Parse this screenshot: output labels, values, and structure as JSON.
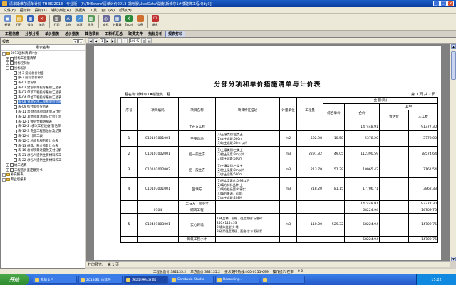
{
  "window": {
    "title": "清华斯维尔清单计价 TH-BQ2013 - 专业版 - [F:\\THSware\\清单计价2013 湖南版\\UserData\\湖南\\斯维尔1#楼建筑工程.Qdy3]",
    "min": "_",
    "max": "□",
    "close": "×"
  },
  "menu": [
    "文件(F)",
    "招标标",
    "投标(T)",
    "辅助功能(A)",
    "数据库",
    "工具",
    "窗口(W)",
    "帮助(H)"
  ],
  "toolbar": [
    {
      "label": "新建",
      "icon": "new-file-icon",
      "color": "#6a8fd0",
      "glyph": "▣"
    },
    {
      "label": "打开",
      "icon": "folder-open-icon",
      "color": "#d8a830",
      "glyph": "▤"
    },
    {
      "label": "保存",
      "icon": "save-icon",
      "color": "#3060b8",
      "glyph": "▦"
    },
    {
      "label": "关闭",
      "icon": "close-file-icon",
      "color": "#c04030",
      "glyph": "✕"
    },
    {
      "label": "打印",
      "icon": "printer-icon",
      "color": "#707070",
      "glyph": "▥"
    },
    {
      "label": "字符",
      "icon": "font-icon",
      "color": "#4070b0",
      "glyph": "A"
    },
    {
      "label": "选项",
      "icon": "options-icon",
      "color": "#4a90d0",
      "glyph": "✓"
    },
    {
      "label": "显示",
      "icon": "display-icon",
      "color": "#5a9a5a",
      "glyph": "▩"
    },
    {
      "label": "查找",
      "icon": "search-icon",
      "color": "#6a6a9a",
      "glyph": "◎"
    },
    {
      "label": "计算器",
      "icon": "calculator-icon",
      "color": "#5a7ab0",
      "glyph": "▦"
    },
    {
      "label": "Excel",
      "icon": "excel-icon",
      "color": "#2a8a3a",
      "glyph": "X"
    },
    {
      "label": "信息",
      "icon": "info-icon",
      "color": "#d07030",
      "glyph": "i"
    },
    {
      "label": "退出",
      "icon": "exit-icon",
      "color": "#c03030",
      "glyph": "⏻"
    }
  ],
  "tabs": [
    "工程信息",
    "分部分项",
    "单价措施",
    "总价措施",
    "其他项目",
    "工料机汇总",
    "取费文件",
    "指标分析",
    "报表打印"
  ],
  "active_tab_index": 8,
  "left_panel": {
    "header": "报表",
    "title": "报表名称",
    "btn_add": "+",
    "btn_close": "×",
    "items": [
      {
        "indent": 0,
        "exp": "-",
        "type": "folder",
        "label": "2013国标清单计价",
        "selected": false
      },
      {
        "indent": 1,
        "exp": "+",
        "type": "check",
        "label": "招标工程量清单",
        "selected": false
      },
      {
        "indent": 1,
        "exp": "+",
        "type": "check",
        "label": "招标控制价",
        "selected": false
      },
      {
        "indent": 1,
        "exp": "-",
        "type": "check",
        "label": "投标报价",
        "selected": false
      },
      {
        "indent": 2,
        "exp": "",
        "type": "check",
        "label": "封-3 投标总价封面",
        "selected": false
      },
      {
        "indent": 2,
        "exp": "",
        "type": "check",
        "label": "扉-3 投标总价扉页",
        "selected": false
      },
      {
        "indent": 2,
        "exp": "",
        "type": "check",
        "label": "表-01 总说明",
        "selected": false
      },
      {
        "indent": 2,
        "exp": "",
        "type": "check",
        "label": "表-02 建设项目投标报价汇总表",
        "selected": false
      },
      {
        "indent": 2,
        "exp": "",
        "type": "check",
        "label": "表-03 单项工程投标报价汇总表",
        "selected": false
      },
      {
        "indent": 2,
        "exp": "",
        "type": "check",
        "label": "表-04 单位工程投标报价汇总表",
        "selected": false
      },
      {
        "indent": 2,
        "exp": "",
        "type": "check",
        "label": "表-08 分部分项工程和单价措施",
        "selected": true
      },
      {
        "indent": 2,
        "exp": "",
        "type": "check",
        "label": "表-09 综合单价分析表",
        "selected": false
      },
      {
        "indent": 2,
        "exp": "",
        "type": "check",
        "label": "表-11 总价措施项目清单与计价",
        "selected": false
      },
      {
        "indent": 2,
        "exp": "",
        "type": "check",
        "label": "表-12 其他项目清单与计价汇总",
        "selected": false
      },
      {
        "indent": 2,
        "exp": "",
        "type": "check",
        "label": "表-12-1 暂列金额明细表",
        "selected": false
      },
      {
        "indent": 2,
        "exp": "",
        "type": "check",
        "label": "表-12-2 材料(工程设备)暂估单",
        "selected": false
      },
      {
        "indent": 2,
        "exp": "",
        "type": "check",
        "label": "表-12-3 专业工程暂估价及结算",
        "selected": false
      },
      {
        "indent": 2,
        "exp": "",
        "type": "check",
        "label": "表-12-4 计日工表",
        "selected": false
      },
      {
        "indent": 2,
        "exp": "",
        "type": "check",
        "label": "表-12-5 总承包服务费计价表",
        "selected": false
      },
      {
        "indent": 2,
        "exp": "",
        "type": "check",
        "label": "表-13 规费、税金项目计价表",
        "selected": false
      },
      {
        "indent": 2,
        "exp": "",
        "type": "check",
        "label": "表-16 总价项目进度款支付分解",
        "selected": false
      },
      {
        "indent": 2,
        "exp": "",
        "type": "check",
        "label": "表-21 承包人提供主要材料和工",
        "selected": false
      },
      {
        "indent": 2,
        "exp": "",
        "type": "check",
        "label": "表-22 承包人提供主要材料和工",
        "selected": false
      },
      {
        "indent": 1,
        "exp": "+",
        "type": "check",
        "label": "竣工结算",
        "selected": false
      },
      {
        "indent": 1,
        "exp": "+",
        "type": "check",
        "label": "工程造价鉴定意见书",
        "selected": false
      },
      {
        "indent": 0,
        "exp": "+",
        "type": "folder",
        "label": "补充报表",
        "selected": false
      },
      {
        "indent": 0,
        "exp": "+",
        "type": "folder",
        "label": "专业版报表",
        "selected": false
      }
    ]
  },
  "doc_toolbar": {
    "page_input": "1",
    "zoom": "100 %"
  },
  "report": {
    "title": "分部分项和单价措施清单与计价表",
    "project_label": "工程名称:斯维尔1#楼建筑工程",
    "page_label": "第 1 页 共 2 页",
    "headers": {
      "seq": "序号",
      "code": "项目编码",
      "name": "项目名称",
      "feature": "项目特征描述",
      "unit": "计量单位",
      "qty": "工程量",
      "amount_group": "金 额(元)",
      "unit_price": "综合单价",
      "total": "合价",
      "of_which": "其中",
      "provisional": "暂估价",
      "labor": "人工费"
    },
    "rows": [
      {
        "kind": "section",
        "seq": "",
        "code": "",
        "name": "土石方工程",
        "feature": "",
        "unit": "",
        "qty": "",
        "price": "",
        "total": "147448.91",
        "prov": "",
        "labor": "91377.30",
        "h": 11
      },
      {
        "kind": "item",
        "seq": "1",
        "code": "010101001001",
        "name": "平整场地",
        "feature": "(1)土壤类别:三类土\n(2)弃土运距:500m\n(3)取土运距:50m 以内",
        "unit": "m2",
        "qty": "502.98",
        "price": "10.58",
        "total": "5378.20",
        "prov": "",
        "labor": "3778.00",
        "h": 22
      },
      {
        "kind": "item",
        "seq": "2",
        "code": "010101002001",
        "name": "挖一般土方",
        "feature": "(1)土壤类别:三类土\n(2)挖土深度:3m以内\n(3)弃土运距:500m",
        "unit": "m3",
        "qty": "2291.32",
        "price": "49.05",
        "total": "112390.59",
        "prov": "",
        "labor": "78574.64",
        "h": 22
      },
      {
        "kind": "item",
        "seq": "3",
        "code": "010101002002",
        "name": "挖一般土方",
        "feature": "(1)土壤类别:三类土\n(2)挖土深度:3m以内\n(3)弃土运距:500m",
        "unit": "m3",
        "qty": "213.79",
        "price": "51.29",
        "total": "10965.42",
        "prov": "",
        "labor": "7161.54",
        "h": 22
      },
      {
        "kind": "item",
        "seq": "4",
        "code": "010103001001",
        "name": "回填方",
        "feature": "(1)密实度要求:0.93以下\n(2)填方材料品种:土\n(3)填方粒径要求:密实\n(4)填方来源、运距:\n(5)弃土运距:208M",
        "unit": "m3",
        "qty": "218.20",
        "price": "81.15",
        "total": "17706.71",
        "prov": "",
        "labor": "3862.33",
        "h": 32
      },
      {
        "kind": "sub",
        "seq": "",
        "code": "",
        "name": "土石方工程小计",
        "feature": "",
        "unit": "",
        "qty": "",
        "price": "",
        "total": "147448.91",
        "prov": "",
        "labor": "93377.30",
        "h": 9
      },
      {
        "kind": "section",
        "seq": "",
        "code": "0104",
        "name": "砌筑工程",
        "feature": "",
        "unit": "",
        "qty": "",
        "price": "",
        "total": "58224.94",
        "prov": "",
        "labor": "14709.75",
        "h": 9
      },
      {
        "kind": "item",
        "seq": "5",
        "code": "010401003001",
        "name": "实心砖墙",
        "feature": "1.砖品种、规格、强度等级:标准砖\n240×115×53\n2.墙体类型:外墙\n3.砂浆强度等级、配合比:水泥砂浆",
        "unit": "m3",
        "qty": "110.00",
        "price": "529.32",
        "total": "58224.94",
        "prov": "",
        "labor": "14709.75",
        "h": 32
      },
      {
        "kind": "sub",
        "seq": "",
        "code": "",
        "name": "砌筑工程小计",
        "feature": "",
        "unit": "",
        "qty": "",
        "price": "",
        "total": "58224.94",
        "prov": "",
        "labor": "14709.75",
        "h": 9
      }
    ]
  },
  "hscroll_label": "打印预览:",
  "hscroll_page": "第 1 页",
  "status": {
    "cost": "工程总造价:382135.2",
    "unit_cost": "单方造价:382135.2",
    "support": "技术支持热线:400-0755-699",
    "mode": "操作提示:在审",
    "indicator": "0 0"
  },
  "taskbar": {
    "start": "开始",
    "items": [
      "我的文档",
      "2013版计价软件",
      "清华斯维尔清单计",
      "Camtasia Studio",
      "Recording...",
      ""
    ],
    "active_index": 2,
    "clock": "15:22"
  }
}
